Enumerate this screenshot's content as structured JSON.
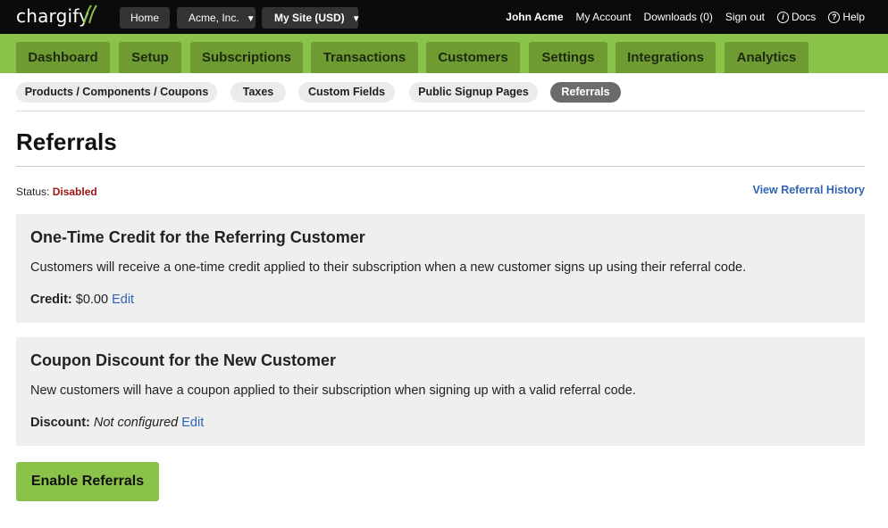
{
  "brand": {
    "name": "chargify"
  },
  "topbar": {
    "home_label": "Home",
    "org_label": "Acme, Inc.",
    "site_label": "My Site (USD)",
    "user_name": "John Acme",
    "links": {
      "my_account": "My Account",
      "downloads": "Downloads (0)",
      "sign_out": "Sign out",
      "docs": "Docs",
      "help": "Help"
    }
  },
  "nav": {
    "tabs": [
      "Dashboard",
      "Setup",
      "Subscriptions",
      "Transactions",
      "Customers",
      "Settings",
      "Integrations",
      "Analytics"
    ]
  },
  "subnav": {
    "tabs": [
      "Products / Components / Coupons",
      "Taxes",
      "Custom Fields",
      "Public Signup Pages",
      "Referrals"
    ],
    "active": "Referrals"
  },
  "page": {
    "title": "Referrals",
    "status_label": "Status:",
    "status_value": "Disabled",
    "history_link": "View Referral History"
  },
  "credit_panel": {
    "heading": "One-Time Credit for the Referring Customer",
    "description": "Customers will receive a one-time credit applied to their subscription when a new customer signs up using their referral code.",
    "key": "Credit:",
    "value": "$0.00",
    "edit_label": "Edit"
  },
  "discount_panel": {
    "heading": "Coupon Discount for the New Customer",
    "description": "New customers will have a coupon applied to their subscription when signing up with a valid referral code.",
    "key": "Discount:",
    "value": "Not configured",
    "edit_label": "Edit"
  },
  "actions": {
    "enable_label": "Enable Referrals"
  },
  "colors": {
    "nav_green": "#8bc34a",
    "tab_green": "#6f9c32",
    "status_disabled": "#a01515",
    "link_blue": "#2f63b5"
  }
}
